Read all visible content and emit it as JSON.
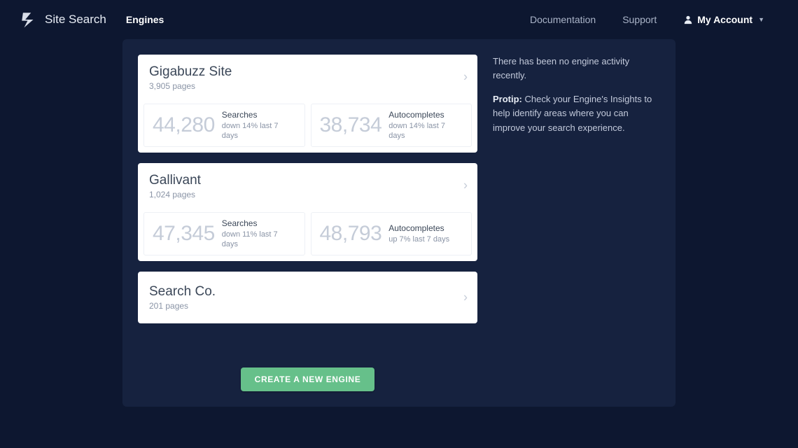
{
  "header": {
    "brand": "Site Search",
    "nav_engines": "Engines",
    "documentation": "Documentation",
    "support": "Support",
    "my_account": "My Account"
  },
  "engines": [
    {
      "name": "Gigabuzz Site",
      "pages": "3,905 pages",
      "searches_value": "44,280",
      "searches_label": "Searches",
      "searches_sub": "down 14% last 7 days",
      "auto_value": "38,734",
      "auto_label": "Autocompletes",
      "auto_sub": "down 14% last 7 days",
      "has_stats": true
    },
    {
      "name": "Gallivant",
      "pages": "1,024 pages",
      "searches_value": "47,345",
      "searches_label": "Searches",
      "searches_sub": "down 11% last 7 days",
      "auto_value": "48,793",
      "auto_label": "Autocompletes",
      "auto_sub": "up 7% last 7 days",
      "has_stats": true
    },
    {
      "name": "Search Co.",
      "pages": "201 pages",
      "has_stats": false
    }
  ],
  "sidebar": {
    "no_activity": "There has been no engine activity recently.",
    "protip_label": "Protip:",
    "protip_text": " Check your Engine's Insights to help identify areas where you can improve your search experience."
  },
  "create_button": "CREATE A NEW ENGINE"
}
